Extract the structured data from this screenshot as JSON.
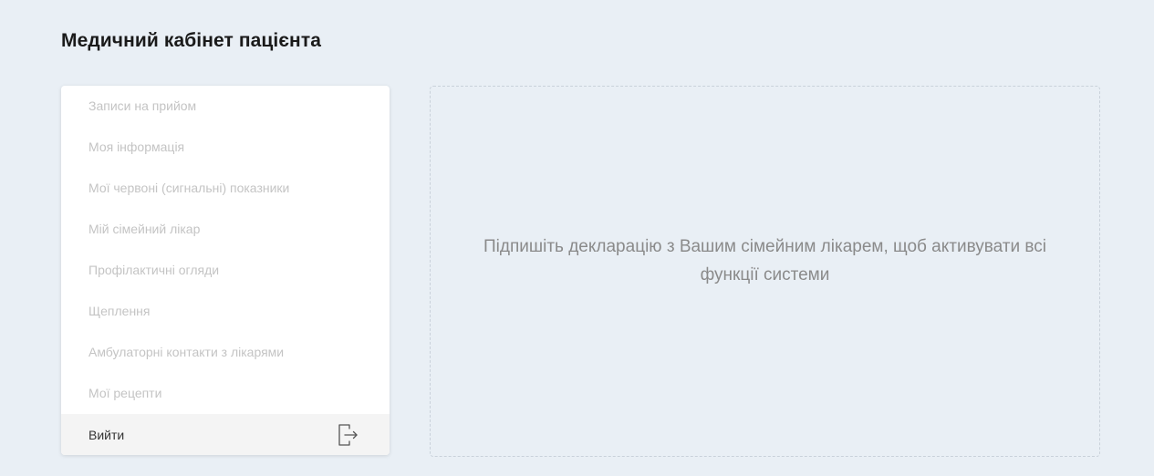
{
  "page": {
    "title": "Медичний кабінет пацієнта"
  },
  "sidebar": {
    "items": [
      {
        "label": "Записи на прийом"
      },
      {
        "label": "Моя інформація"
      },
      {
        "label": "Мої червоні (сигнальні) показники"
      },
      {
        "label": "Мій сімейний лікар"
      },
      {
        "label": "Профілактичні огляди"
      },
      {
        "label": "Щеплення"
      },
      {
        "label": "Амбулаторні контакти з лікарями"
      },
      {
        "label": "Мої рецепти"
      }
    ],
    "logout": {
      "label": "Вийти",
      "icon": "logout-icon"
    }
  },
  "main": {
    "notice": "Підпишіть декларацію з Вашим сімейним лікарем, щоб активувати всі функції системи"
  },
  "colors": {
    "background": "#e9eff5",
    "menu_text_disabled": "#c4c4c4",
    "notice_text": "#8a8a8a"
  }
}
